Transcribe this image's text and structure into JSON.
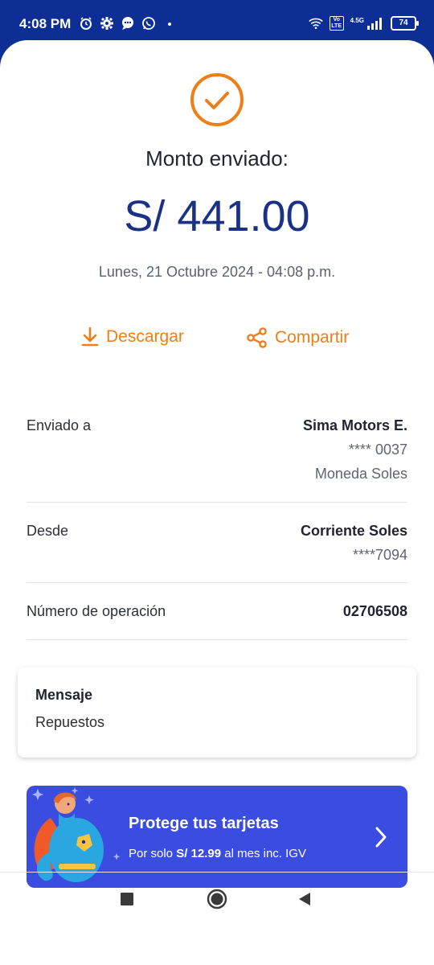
{
  "status_bar": {
    "time": "4:08 PM",
    "battery": "74",
    "network": "4.5G",
    "volte": "Vo LTE"
  },
  "receipt": {
    "title": "Monto enviado:",
    "amount": "S/ 441.00",
    "datetime": "Lunes, 21 Octubre 2024 - 04:08 p.m."
  },
  "actions": {
    "download_label": "Descargar",
    "share_label": "Compartir"
  },
  "details": {
    "sent_to": {
      "label": "Enviado a",
      "name": "Sima Motors E.",
      "account": "**** 0037",
      "currency": "Moneda Soles"
    },
    "from": {
      "label": "Desde",
      "account_type": "Corriente Soles",
      "account": "****7094"
    },
    "operation": {
      "label": "Número de operación",
      "number": "02706508"
    }
  },
  "message": {
    "title": "Mensaje",
    "text": "Repuestos"
  },
  "promo": {
    "title": "Protege tus tarjetas",
    "sub_prefix": "Por solo ",
    "sub_price": "S/ 12.99",
    "sub_suffix": " al mes inc. IGV"
  },
  "colors": {
    "accent_orange": "#ef7e16",
    "amount_blue": "#1a3185",
    "status_bar_blue": "#0d2f95",
    "promo_blue": "#3a4de0"
  },
  "icons": {
    "status_left": [
      "alarm-icon",
      "settings-icon",
      "chat-icon",
      "whatsapp-icon"
    ],
    "status_right": [
      "wifi-icon",
      "volte-icon",
      "signal-icon",
      "battery-icon"
    ],
    "success": "check-circle-icon",
    "download": "download-icon",
    "share": "share-icon",
    "promo_next": "chevron-right-icon",
    "nav": [
      "recent-apps-icon",
      "home-icon",
      "back-icon"
    ]
  }
}
